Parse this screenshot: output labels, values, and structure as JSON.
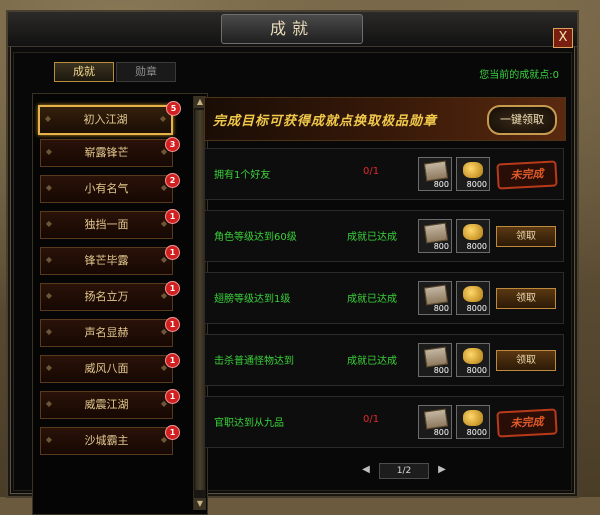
{
  "window": {
    "title": "成就",
    "close_label": "X"
  },
  "tabs": [
    {
      "label": "成就"
    },
    {
      "label": "勋章"
    }
  ],
  "points_label": "您当前的成就点:0",
  "achievements": [
    {
      "label": "初入江湖",
      "badge": "5",
      "selected": true
    },
    {
      "label": "崭露锋芒",
      "badge": "3"
    },
    {
      "label": "小有名气",
      "badge": "2"
    },
    {
      "label": "独挡一面",
      "badge": "1"
    },
    {
      "label": "锋芒毕露",
      "badge": "1"
    },
    {
      "label": "扬名立万",
      "badge": "1"
    },
    {
      "label": "声名显赫",
      "badge": "1"
    },
    {
      "label": "威风八面",
      "badge": "1"
    },
    {
      "label": "威震江湖",
      "badge": "1"
    },
    {
      "label": "沙城霸主",
      "badge": "1"
    }
  ],
  "banner": {
    "text": "完成目标可获得成就点换取极品勋章",
    "claim_all_label": "一键领取"
  },
  "rows": [
    {
      "name": "拥有1个好友",
      "progress": "0/1",
      "reward1_qty": "800",
      "reward2_qty": "8000",
      "action": "未完成"
    },
    {
      "name": "角色等级达到60级",
      "status": "成就已达成",
      "reward1_qty": "800",
      "reward2_qty": "8000",
      "action": "领取"
    },
    {
      "name": "翅膀等级达到1级",
      "status": "成就已达成",
      "reward1_qty": "800",
      "reward2_qty": "8000",
      "action": "领取"
    },
    {
      "name": "击杀普通怪物达到",
      "status": "成就已达成",
      "reward1_qty": "800",
      "reward2_qty": "8000",
      "action": "领取"
    },
    {
      "name": "官职达到从九品",
      "progress": "0/1",
      "reward1_qty": "800",
      "reward2_qty": "8000",
      "action": "未完成"
    }
  ],
  "pager": {
    "page": "1/2",
    "prev": "◀",
    "next": "▶"
  },
  "icons": {
    "reward1": "scroll-icon",
    "reward2": "gold-coins-icon"
  },
  "colors": {
    "green": "#3ad13a",
    "red": "#e02a2a",
    "gold": "#f0c94b"
  }
}
